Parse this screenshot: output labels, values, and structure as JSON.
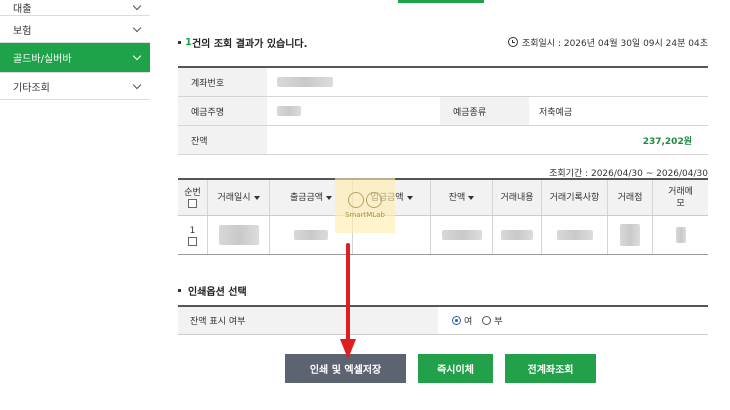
{
  "sidebar": {
    "items": [
      {
        "label": "대출"
      },
      {
        "label": "보험"
      },
      {
        "label": "골드바/실버바"
      },
      {
        "label": "기타조회"
      }
    ]
  },
  "result": {
    "count": "1",
    "title_suffix": "건의 조회 결과가 있습니다.",
    "query_time": "조회일시 : 2026년 04월 30일 09시 24분 04초"
  },
  "account": {
    "account_no_label": "계좌번호",
    "holder_label": "예금주명",
    "type_label": "예금종류",
    "type_value": "저축예금",
    "balance_label": "잔액",
    "balance_value": "237,202원"
  },
  "period": "조회기간 : 2026/04/30 ~ 2026/04/30",
  "transactions": {
    "headers": {
      "no": "순번",
      "date": "거래일시",
      "withdraw": "출금금액",
      "deposit": "입금금액",
      "balance": "잔액",
      "content": "거래내용",
      "record": "거래기록사항",
      "branch": "거래점",
      "memo": "거래메모"
    },
    "rows": [
      {
        "no": "1"
      }
    ]
  },
  "watermark": "SmartMLab",
  "print": {
    "section_title": "인쇄옵션 선택",
    "balance_show_label": "잔액 표시 여부",
    "options": [
      "여",
      "부"
    ],
    "selected": "여"
  },
  "buttons": {
    "print_excel": "인쇄 및 엑셀저장",
    "instant_transfer": "즉시이체",
    "all_accounts": "전계좌조회"
  },
  "colors": {
    "accent": "#1ea34a",
    "dark_button": "#5c6371",
    "arrow": "#e01e1e"
  }
}
